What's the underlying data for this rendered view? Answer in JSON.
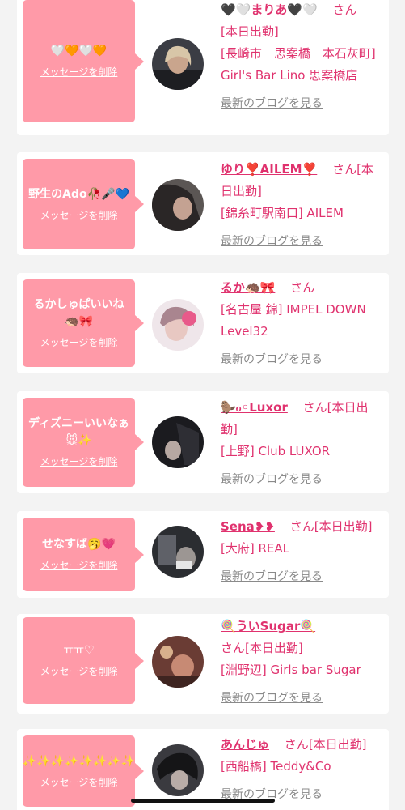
{
  "delete_label": "メッセージを削除",
  "blog_label": "最新のブログを見る",
  "san": "さん",
  "cards": [
    {
      "message": "🤍🧡🤍🧡",
      "name": "🖤🤍まりあ🖤🤍",
      "status": "[本日出勤]",
      "shop": "[長崎市　思案橋　本石灰町] Girl's Bar Lino 思案橋店",
      "avatar_color": "#3a3a40"
    },
    {
      "message": "野生のAdo🥀🎤💙",
      "name": "ゆり❣️AILEM❣️",
      "status": "[本日出勤]",
      "shop": "[錦糸町駅南口] AILEM",
      "avatar_color": "#4a4546"
    },
    {
      "message": "るかしゅぱいいね🦔🎀",
      "name": "るか🦔🎀",
      "status": "",
      "shop": "[名古屋 錦] IMPEL DOWN Level32",
      "avatar_color": "#d9b3c0"
    },
    {
      "message": "ディズニーいいなぁ🐭✨",
      "name": "🦫ℴ◦Luxor",
      "status": "[本日出勤]",
      "shop": "[上野] Club LUXOR",
      "avatar_color": "#1e1e22"
    },
    {
      "message": "せなすば🥱💗",
      "name": "Sena❥❥",
      "status": "[本日出勤]",
      "shop": "[大府] REAL",
      "avatar_color": "#2a2c30"
    },
    {
      "message": "ㅠㅠ♡",
      "name": "🍭ういSugar🍭",
      "status": "[本日出勤]",
      "shop": "[淵野辺] Girls bar Sugar",
      "avatar_color": "#7a4a40"
    },
    {
      "message": "✨✨✨✨✨✨✨✨",
      "name": "あんじゅ",
      "status": "[本日出勤]",
      "shop": "[西船橋] Teddy&Co",
      "avatar_color": "#2f2f33"
    }
  ]
}
